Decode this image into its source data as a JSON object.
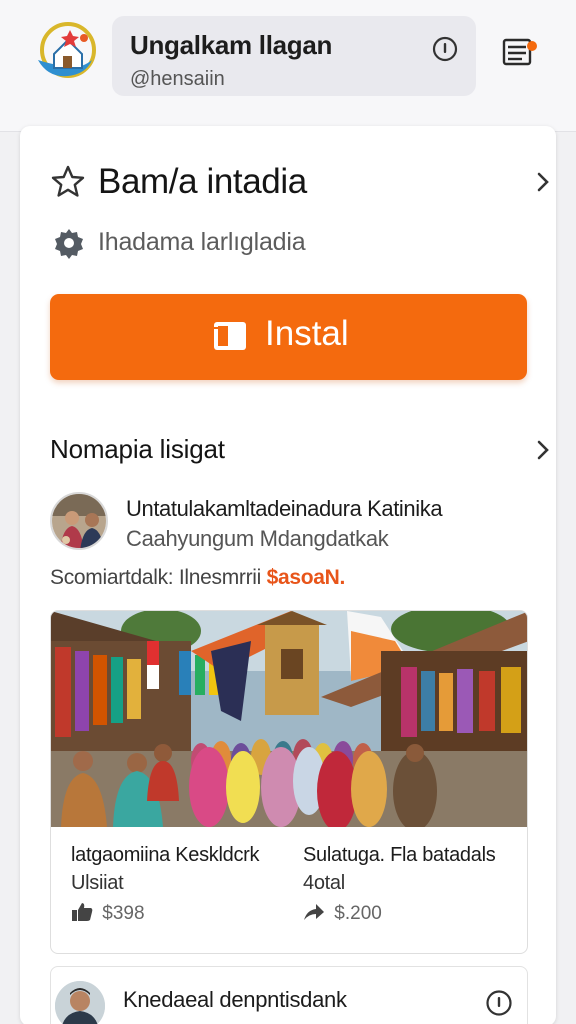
{
  "header": {
    "account_name": "Ungalkam llagan",
    "account_handle": "@hensaiin",
    "logo_icon": "home-heart-logo",
    "info_icon": "info-icon",
    "menu_icon": "menu-notification-icon"
  },
  "app": {
    "title": "Bam/a intadia",
    "developer": "Ihadama larlıgladia",
    "install_label": "Instal",
    "accent_color": "#f46a0e"
  },
  "section": {
    "title": "Nomapia lisigat"
  },
  "post": {
    "author": "Untatulakamltadeinadura Katinika",
    "subtitle": "Caahyungum Mdangdatkak",
    "meta_prefix": "Scomiartdalk: Ilnesmrrii",
    "meta_highlight": "$asoaN."
  },
  "listings": [
    {
      "title": "latgaomiina Keskldcrk",
      "subtitle": "Ulsiiat",
      "price": "$398",
      "price_icon": "thumbs-up-icon"
    },
    {
      "title": "Sulatuga. Fla batadals",
      "subtitle": "4otal",
      "price": "$.200",
      "price_icon": "share-arrow-icon"
    }
  ],
  "post2": {
    "name": "Knedaeal denpntisdank",
    "info_icon": "info-icon"
  }
}
